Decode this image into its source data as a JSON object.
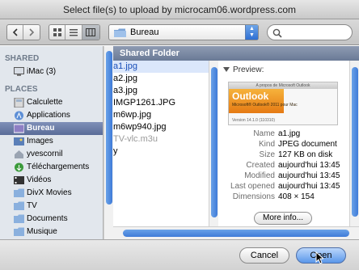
{
  "window": {
    "title": "Select file(s) to upload by microcam06.wordpress.com"
  },
  "toolbar": {
    "location": "Bureau",
    "search_placeholder": ""
  },
  "sidebar": {
    "shared_header": "SHARED",
    "shared_items": [
      {
        "label": "iMac (3)",
        "icon": "imac-icon"
      }
    ],
    "places_header": "PLACES",
    "places_items": [
      {
        "label": "Calculette",
        "icon": "calculator-icon"
      },
      {
        "label": "Applications",
        "icon": "applications-icon"
      },
      {
        "label": "Bureau",
        "icon": "desktop-icon",
        "active": true
      },
      {
        "label": "Images",
        "icon": "images-icon"
      },
      {
        "label": "yvescornil",
        "icon": "home-icon"
      },
      {
        "label": "Téléchargements",
        "icon": "downloads-icon"
      },
      {
        "label": "Vidéos",
        "icon": "videos-icon"
      },
      {
        "label": "DivX Movies",
        "icon": "movies-icon"
      },
      {
        "label": "TV",
        "icon": "tv-icon"
      },
      {
        "label": "Documents",
        "icon": "documents-icon"
      },
      {
        "label": "Musique",
        "icon": "music-icon"
      }
    ]
  },
  "browser": {
    "column_title": "Shared Folder",
    "files": [
      {
        "name": "a1.jpg",
        "selected": true
      },
      {
        "name": "a2.jpg"
      },
      {
        "name": "a3.jpg"
      },
      {
        "name": "IMGP1261.JPG"
      },
      {
        "name": "m6wp.jpg"
      },
      {
        "name": "m6wp940.jpg"
      },
      {
        "name": "TV-vlc.m3u",
        "dim": true
      },
      {
        "name": "y"
      }
    ]
  },
  "preview": {
    "heading": "Preview:",
    "thumb_title": "A propos de Microsoft Outlook",
    "thumb_brand": "Outlook",
    "thumb_subtitle": "Microsoft® Outlook® 2011 pour Mac",
    "thumb_version": "Version 14.1.0 (110310)",
    "fields": [
      {
        "key": "Name",
        "value": "a1.jpg"
      },
      {
        "key": "Kind",
        "value": "JPEG document"
      },
      {
        "key": "Size",
        "value": "127 KB on disk"
      },
      {
        "key": "Created",
        "value": "aujourd'hui 13:45"
      },
      {
        "key": "Modified",
        "value": "aujourd'hui 13:45"
      },
      {
        "key": "Last opened",
        "value": "aujourd'hui 13:45"
      },
      {
        "key": "Dimensions",
        "value": "408 × 154"
      }
    ],
    "more_info": "More info..."
  },
  "footer": {
    "cancel": "Cancel",
    "open": "Open"
  },
  "colors": {
    "accent": "#3f7bd8",
    "sidebar_active": "#5a6c98",
    "header": "#7a88a3"
  }
}
